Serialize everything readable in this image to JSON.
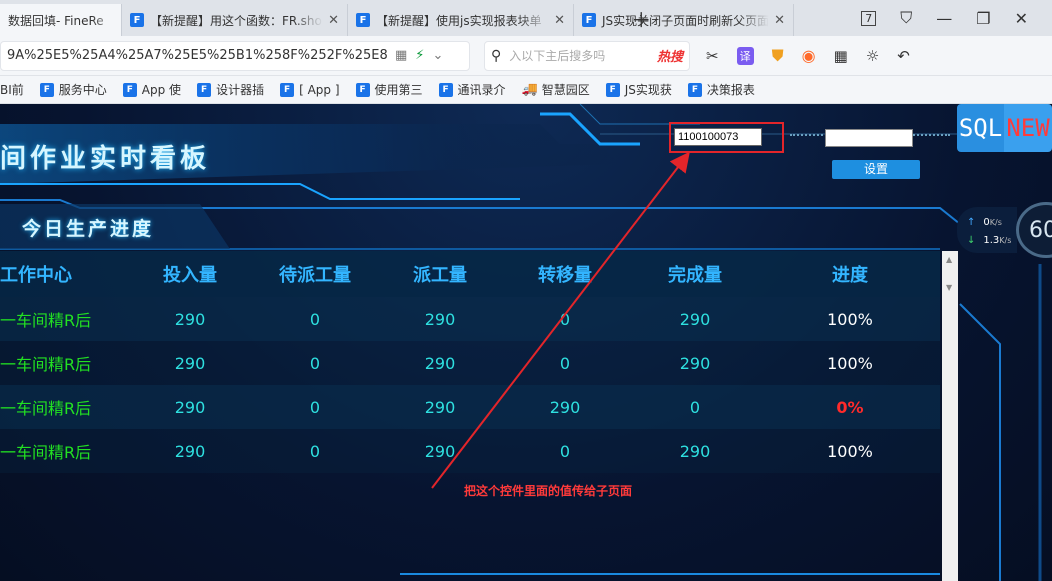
{
  "browser": {
    "tabs": [
      {
        "label": "数据回填- FineRe",
        "favicon": ""
      },
      {
        "label": "【新提醒】用这个函数：FR.sho",
        "favicon": "F"
      },
      {
        "label": "【新提醒】使用js实现报表块单",
        "favicon": "F"
      },
      {
        "label": "JS实现关闭子页面时刷新父页面",
        "favicon": "F"
      }
    ],
    "tab_count": "7",
    "url": "9A%25E5%25A4%25A7%25E5%25B1%258F%252F%25E8%",
    "search_placeholder": "入以下主后搜多吗",
    "search_hot": "热搜",
    "translate_label": "译",
    "bookmarks": [
      {
        "label": "BI前"
      },
      {
        "label": "服务中心"
      },
      {
        "label": "App 使"
      },
      {
        "label": "设计器插"
      },
      {
        "label": "[ App ]"
      },
      {
        "label": "使用第三"
      },
      {
        "label": "通讯录介"
      },
      {
        "label": "智慧园区"
      },
      {
        "label": "JS实现获"
      },
      {
        "label": "决策报表"
      }
    ]
  },
  "dashboard": {
    "title": "间作业实时看板",
    "section_title": "今日生产进度",
    "id_input_value": "1100100073",
    "set_button_label": "设置",
    "sql_badge": {
      "left": "SQL",
      "right": "NEW"
    },
    "network": {
      "up_value": "0",
      "up_unit": "K/s",
      "down_value": "1.3",
      "down_unit": "K/s"
    },
    "gauge_value": "60",
    "table": {
      "headers": [
        "工作中心",
        "投入量",
        "待派工量",
        "派工量",
        "转移量",
        "完成量",
        "进度"
      ],
      "rows": [
        [
          "一车间精R后",
          "290",
          "0",
          "290",
          "0",
          "290",
          "100%"
        ],
        [
          "一车间精R后",
          "290",
          "0",
          "290",
          "0",
          "290",
          "100%"
        ],
        [
          "一车间精R后",
          "290",
          "0",
          "290",
          "290",
          "0",
          "0%"
        ],
        [
          "一车间精R后",
          "290",
          "0",
          "290",
          "0",
          "290",
          "100%"
        ]
      ]
    },
    "annotation": "把这个控件里面的值传给子页面",
    "colors": {
      "accent": "#33b5ff",
      "green": "#22e022",
      "cyan": "#2ee0e0",
      "alert": "#ff2a2a"
    }
  }
}
